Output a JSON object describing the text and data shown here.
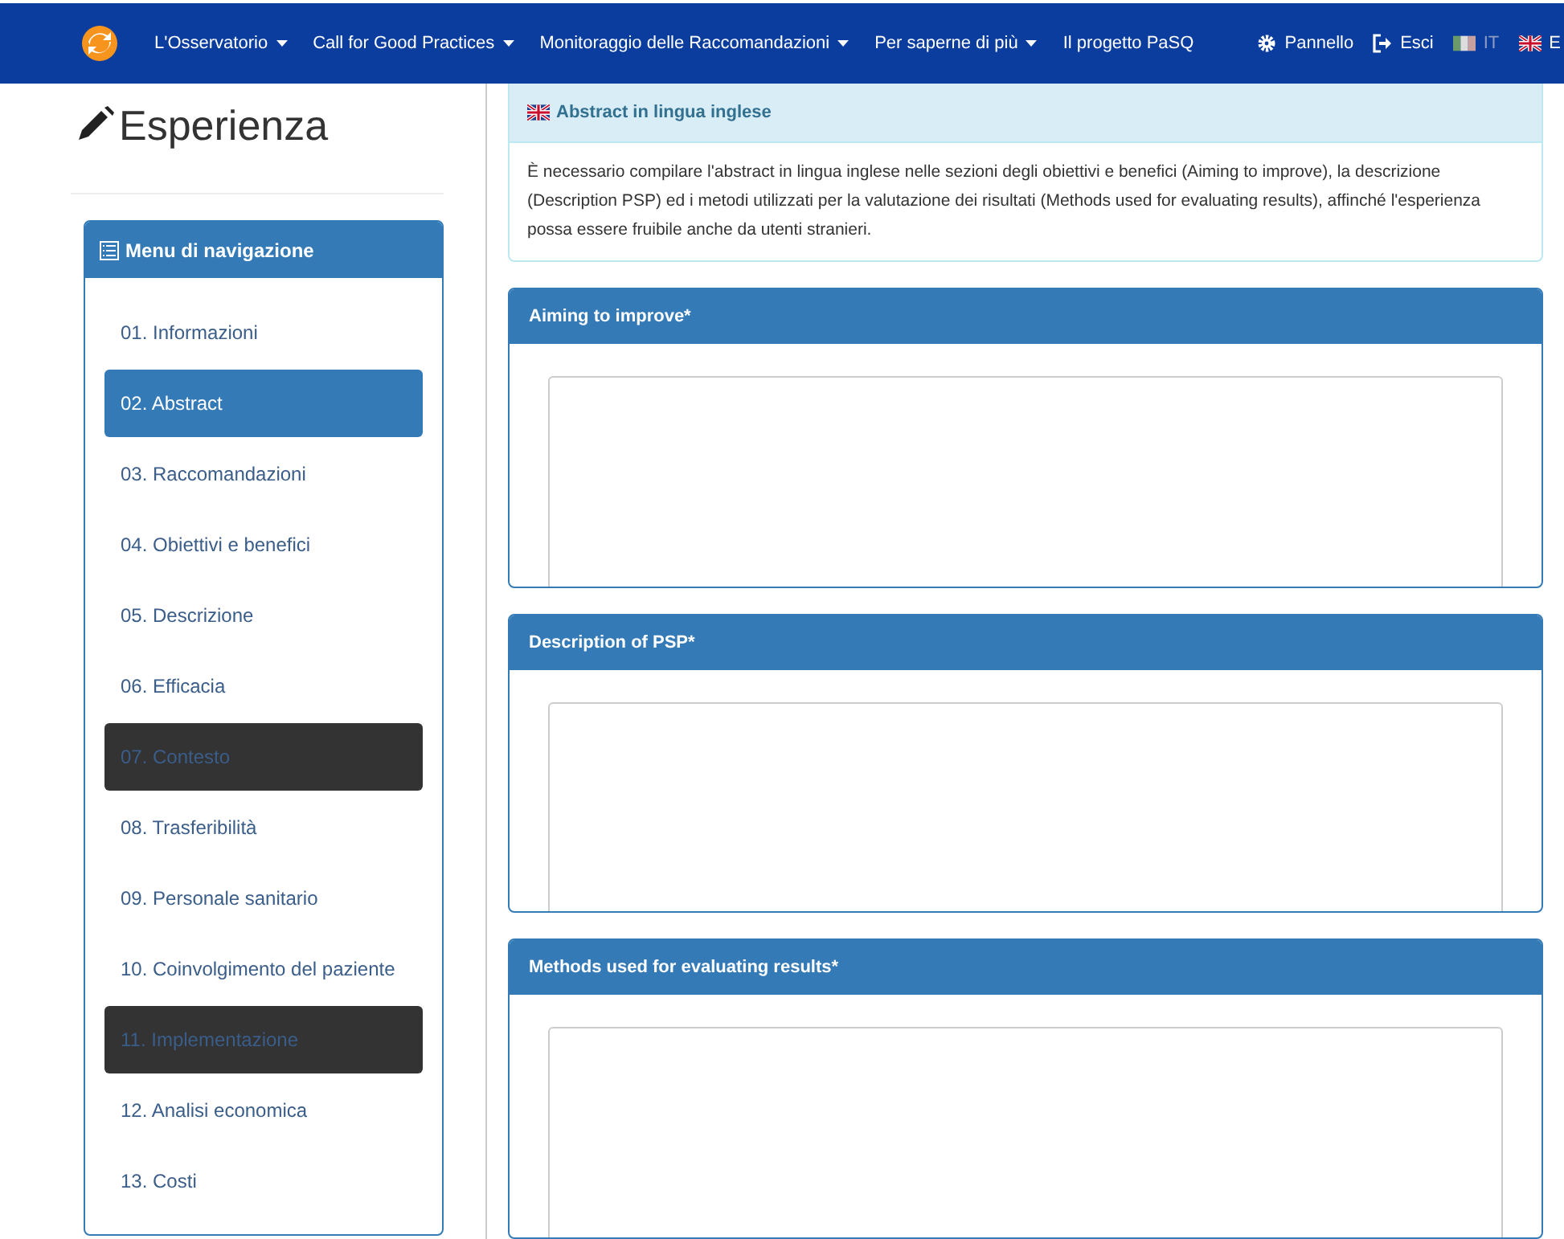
{
  "navbar": {
    "menu": [
      {
        "label": "L'Osservatorio",
        "dropdown": true
      },
      {
        "label": "Call for Good Practices",
        "dropdown": true
      },
      {
        "label": "Monitoraggio delle Raccomandazioni",
        "dropdown": true
      },
      {
        "label": "Per saperne di più",
        "dropdown": true
      },
      {
        "label": "Il progetto PaSQ",
        "dropdown": false
      }
    ],
    "actions": [
      {
        "kind": "gear",
        "label": "Pannello"
      },
      {
        "kind": "logout",
        "label": "Esci"
      }
    ],
    "languages": [
      {
        "kind": "italian",
        "label": "IT",
        "disabled": true
      },
      {
        "kind": "english",
        "label": "E",
        "disabled": false
      }
    ]
  },
  "page_title": "Esperienza",
  "sidebar": {
    "title": "Menu di navigazione",
    "items": [
      {
        "label": "01. Informazioni",
        "selected": false,
        "disabled": false
      },
      {
        "label": "02. Abstract",
        "selected": true,
        "disabled": false
      },
      {
        "label": "03. Raccomandazioni",
        "selected": false,
        "disabled": false
      },
      {
        "label": "04. Obiettivi e benefici",
        "selected": false,
        "disabled": false
      },
      {
        "label": "05. Descrizione",
        "selected": false,
        "disabled": false
      },
      {
        "label": "06. Efficacia",
        "selected": false,
        "disabled": false
      },
      {
        "label": "07. Contesto",
        "selected": false,
        "disabled": true
      },
      {
        "label": "08. Trasferibilità",
        "selected": false,
        "disabled": false
      },
      {
        "label": "09. Personale sanitario",
        "selected": false,
        "disabled": false
      },
      {
        "label": "10. Coinvolgimento del paziente",
        "selected": false,
        "disabled": false
      },
      {
        "label": "11. Implementazione",
        "selected": false,
        "disabled": true
      },
      {
        "label": "12. Analisi economica",
        "selected": false,
        "disabled": false
      },
      {
        "label": "13. Costi",
        "selected": false,
        "disabled": false
      }
    ]
  },
  "info": {
    "title": "Abstract in lingua inglese",
    "text": "È necessario compilare l'abstract in lingua inglese nelle sezioni degli obiettivi e benefici (Aiming to improve), la descrizione (Description PSP) ed i metodi utilizzati per la valutazione dei risultati (Methods used for evaluating results), affinché l'esperienza possa essere fruibile anche da utenti stranieri."
  },
  "fields": [
    {
      "title": "Aiming to improve*"
    },
    {
      "title": "Description of PSP*"
    },
    {
      "title": "Methods used for evaluating results*"
    }
  ]
}
